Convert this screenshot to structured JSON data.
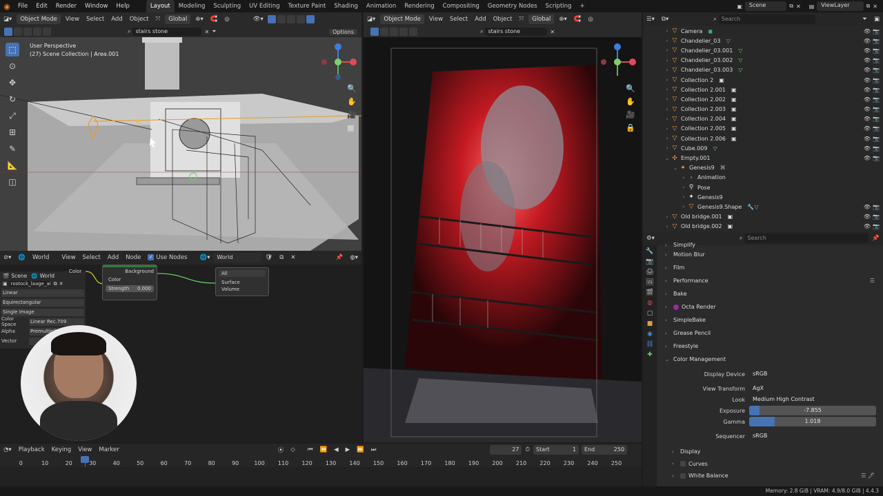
{
  "topbar": {
    "menus": [
      "File",
      "Edit",
      "Render",
      "Window",
      "Help"
    ],
    "workspaces": [
      "Layout",
      "Modeling",
      "Sculpting",
      "UV Editing",
      "Texture Paint",
      "Shading",
      "Animation",
      "Rendering",
      "Compositing",
      "Geometry Nodes",
      "Scripting"
    ],
    "active_workspace": "Layout",
    "add_tab": "+",
    "scene": "Scene",
    "view_layer": "ViewLayer"
  },
  "viewport_left": {
    "mode": "Object Mode",
    "menus": [
      "View",
      "Select",
      "Add",
      "Object"
    ],
    "orientation": "Global",
    "search_value": "stairs stone",
    "options_label": "Options",
    "perspective_label": "User Perspective",
    "collection_label": "(27) Scene Collection | Area.001"
  },
  "viewport_right": {
    "mode": "Object Mode",
    "menus": [
      "View",
      "Select",
      "Add",
      "Object"
    ],
    "orientation": "Global",
    "search_value": "stairs stone"
  },
  "node_editor": {
    "type_label": "World",
    "menus": [
      "View",
      "Select",
      "Add",
      "Node"
    ],
    "use_nodes_label": "Use Nodes",
    "world_name": "World",
    "breadcrumb_scene": "Scene",
    "breadcrumb_world": "World",
    "image_name": "rostock_laage_ai...",
    "image_props": [
      {
        "label": "",
        "value": "Linear"
      },
      {
        "label": "",
        "value": "Equirectangular"
      },
      {
        "label": "",
        "value": "Single Image"
      },
      {
        "label": "Color Space",
        "value": "Linear Rec.709"
      },
      {
        "label": "Alpha",
        "value": "Premultiplied"
      },
      {
        "label": "Vector",
        "value": ""
      }
    ],
    "env_node_output": "Color",
    "bg_node": {
      "title": "Background",
      "input_color": "Color",
      "strength_label": "Strength",
      "strength_value": "0.000"
    },
    "out_node": {
      "target": "All",
      "surface": "Surface",
      "volume": "Volume"
    }
  },
  "outliner": {
    "search_placeholder": "Search",
    "items": [
      {
        "label": "Camera",
        "indent": 0,
        "icon": "camera-icon",
        "extra": "camera"
      },
      {
        "label": "Chandelier_03",
        "indent": 0,
        "icon": "object-icon",
        "extra": "mesh"
      },
      {
        "label": "Chandelier_03.001",
        "indent": 0,
        "icon": "object-icon",
        "extra": "mesh"
      },
      {
        "label": "Chandelier_03.002",
        "indent": 0,
        "icon": "object-icon",
        "extra": "mesh"
      },
      {
        "label": "Chandelier_03.003",
        "indent": 0,
        "icon": "object-icon",
        "extra": "mesh"
      },
      {
        "label": "Collection 2",
        "indent": 0,
        "icon": "object-icon",
        "extra": "collection"
      },
      {
        "label": "Collection 2.001",
        "indent": 0,
        "icon": "object-icon",
        "extra": "collection"
      },
      {
        "label": "Collection 2.002",
        "indent": 0,
        "icon": "object-icon",
        "extra": "collection"
      },
      {
        "label": "Collection 2.003",
        "indent": 0,
        "icon": "object-icon",
        "extra": "collection"
      },
      {
        "label": "Collection 2.004",
        "indent": 0,
        "icon": "object-icon",
        "extra": "collection"
      },
      {
        "label": "Collection 2.005",
        "indent": 0,
        "icon": "object-icon",
        "extra": "collection"
      },
      {
        "label": "Collection 2.006",
        "indent": 0,
        "icon": "object-icon",
        "extra": "collection"
      },
      {
        "label": "Cube.009",
        "indent": 0,
        "icon": "object-icon",
        "extra": "mesh"
      },
      {
        "label": "Empty.001",
        "indent": 0,
        "icon": "empty-icon",
        "extra": ""
      },
      {
        "label": "Genesis9",
        "indent": 1,
        "icon": "armature-icon",
        "extra": "link"
      },
      {
        "label": "Animation",
        "indent": 2,
        "icon": "action-icon",
        "extra": ""
      },
      {
        "label": "Pose",
        "indent": 2,
        "icon": "pose-icon",
        "extra": ""
      },
      {
        "label": "Genesis9",
        "indent": 2,
        "icon": "armature-data-icon",
        "extra": ""
      },
      {
        "label": "Genesis9.Shape",
        "indent": 2,
        "icon": "mesh-icon",
        "extra": "modifiers"
      },
      {
        "label": "Old bridge.001",
        "indent": 0,
        "icon": "object-icon",
        "extra": "collection"
      },
      {
        "label": "Old bridge.002",
        "indent": 0,
        "icon": "object-icon",
        "extra": "collection"
      }
    ]
  },
  "properties": {
    "search_placeholder": "Search",
    "panels": [
      "Simplify",
      "Motion Blur",
      "Film",
      "Performance",
      "Bake",
      "Octa Render",
      "SimpleBake",
      "Grease Pencil",
      "Freestyle",
      "Color Management"
    ],
    "color_management": {
      "display_device_label": "Display Device",
      "display_device": "sRGB",
      "view_transform_label": "View Transform",
      "view_transform": "AgX",
      "look_label": "Look",
      "look": "Medium High Contrast",
      "exposure_label": "Exposure",
      "exposure": "-7.855",
      "exposure_fill": 0.08,
      "gamma_label": "Gamma",
      "gamma": "1.018",
      "gamma_fill": 0.2,
      "sequencer_label": "Sequencer",
      "sequencer": "sRGB"
    },
    "sub_panels": [
      "Display",
      "Curves",
      "White Balance"
    ]
  },
  "timeline": {
    "menus": [
      "Playback",
      "Keying",
      "View",
      "Marker"
    ],
    "current_frame": "27",
    "start_label": "Start",
    "start": "1",
    "end_label": "End",
    "end": "250",
    "ticks": [
      "0",
      "10",
      "20",
      "30",
      "40",
      "50",
      "60",
      "70",
      "80",
      "90",
      "100",
      "110",
      "120",
      "130",
      "140",
      "150",
      "160",
      "170",
      "180",
      "190",
      "200",
      "210",
      "220",
      "230",
      "240",
      "250"
    ],
    "playhead": 27
  },
  "statusbar": {
    "text": "Memory: 2.8 GiB | VRAM: 4.9/8.0 GiB | 4.4.3"
  }
}
